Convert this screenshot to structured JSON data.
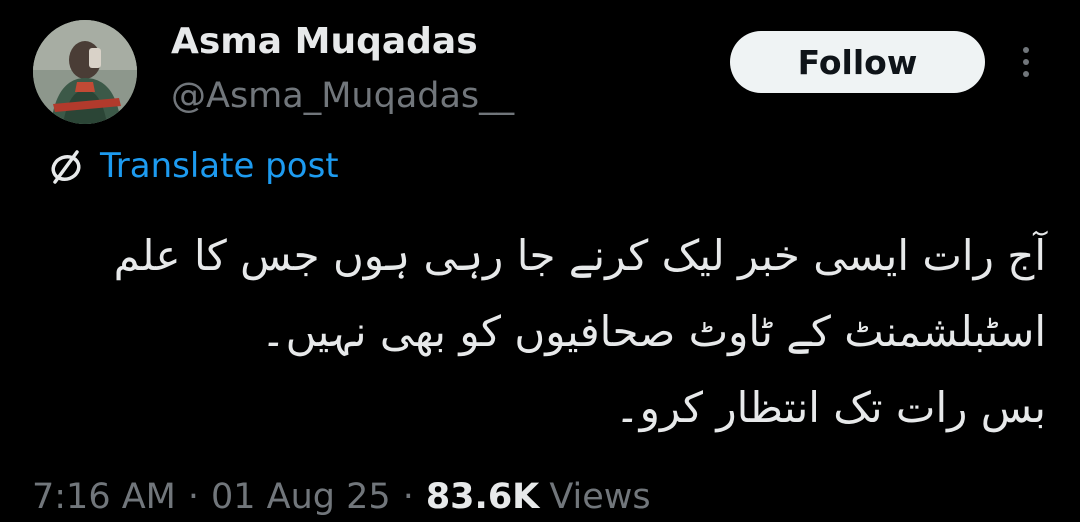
{
  "author": {
    "display_name": "Asma Muqadas",
    "handle": "@Asma_Muqadas__"
  },
  "actions": {
    "follow_label": "Follow",
    "more_icon": "more-vertical-icon"
  },
  "translate": {
    "icon": "translate-globe-icon",
    "label": "Translate post",
    "color": "#1d9bf0"
  },
  "post": {
    "lines": [
      "آج رات ایسی خبر لیک کرنے جا رہی ہوں جس کا علم",
      "اسٹبلشمنٹ کے ٹاوٹ صحافیوں کو بھی نہیں۔",
      "بس رات تک انتظار کرو۔"
    ]
  },
  "meta": {
    "time": "7:16 AM",
    "separator": "·",
    "date": "01 Aug 25",
    "views_count": "83.6K",
    "views_label": "Views"
  },
  "theme": {
    "background": "#000000",
    "text_primary": "#e7e9ea",
    "text_secondary": "#71767b",
    "follow_bg": "#eff3f4"
  }
}
